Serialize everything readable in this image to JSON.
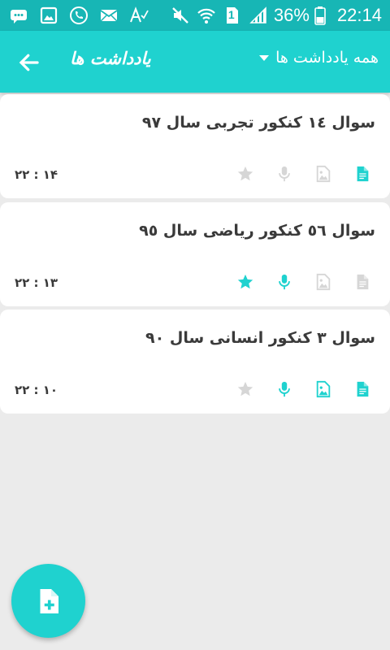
{
  "status_bar": {
    "battery": "36%",
    "time": "22:14",
    "sim_badge": "1",
    "icons": [
      "messages-icon",
      "image-icon",
      "phone-forward-icon",
      "mail-icon",
      "text-service-icon",
      "mute-icon",
      "wifi-icon",
      "sim-icon",
      "signal-icon",
      "battery-icon"
    ]
  },
  "app_bar": {
    "title": "یادداشت ها",
    "filter_label": "همه یادداشت ها"
  },
  "colors": {
    "accent": "#1fd2cf",
    "status_bar": "#17b6b5",
    "icon_inactive": "#d6d6d6",
    "background": "#ebebeb"
  },
  "notes": [
    {
      "title": "سوال ١٤ کنکور تجربی سال ٩٧",
      "time": "۲۲ : ۱۴",
      "document": true,
      "image": false,
      "voice": false,
      "starred": false
    },
    {
      "title": "سوال ٥٦ کنکور ریاضی سال ٩٥",
      "time": "۲۲ : ۱۳",
      "document": false,
      "image": false,
      "voice": true,
      "starred": true
    },
    {
      "title": "سوال ۳ کنکور انسانی سال ۹۰",
      "time": "۲۲ : ۱۰",
      "document": true,
      "image": true,
      "voice": true,
      "starred": false
    }
  ]
}
